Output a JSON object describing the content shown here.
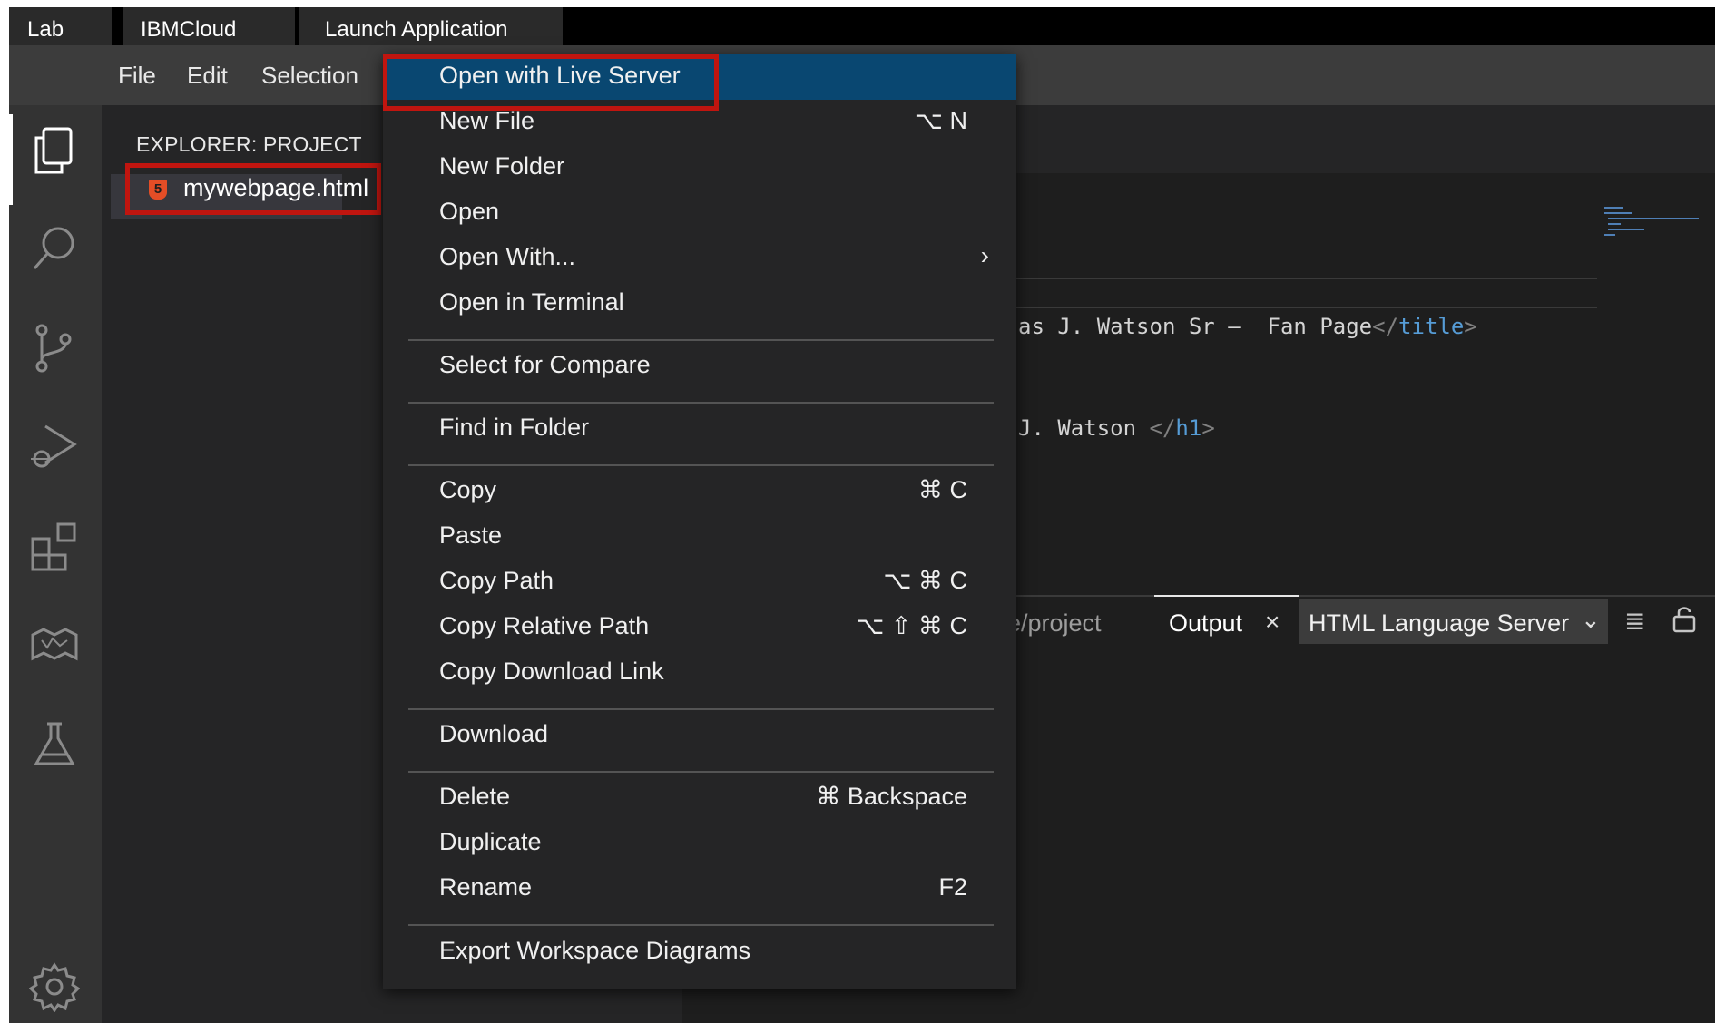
{
  "top_tabs": [
    "Lab",
    "IBMCloud",
    "Launch Application"
  ],
  "menubar": [
    "File",
    "Edit",
    "Selection"
  ],
  "activity_icons": [
    "explorer-icon",
    "search-icon",
    "source-control-icon",
    "run-debug-icon",
    "extensions-icon",
    "map-icon",
    "flask-icon",
    "settings-gear-icon"
  ],
  "explorer": {
    "title": "EXPLORER: PROJECT",
    "file_name": "mywebpage.html",
    "file_icon_glyph": "5"
  },
  "editor": {
    "line1": [
      "as J. Watson Sr –  Fan Page",
      "</",
      "title",
      ">"
    ],
    "line2": [
      "J. Watson ",
      "</",
      "h1",
      ">"
    ]
  },
  "panel": {
    "path_fragment": "e/project",
    "output_tab": "Output",
    "close_glyph": "×",
    "language_select": "HTML Language Server",
    "chevron": "⌄",
    "clear_glyph": "≣",
    "lock_glyph": "🔓"
  },
  "context_menu": {
    "items": [
      {
        "label": "Open with Live Server",
        "key": "",
        "selected": true
      },
      {
        "label": "New File",
        "key": "⌥ N"
      },
      {
        "label": "New Folder",
        "key": ""
      },
      {
        "label": "Open",
        "key": ""
      },
      {
        "label": "Open With...",
        "key": "",
        "submenu": "›"
      },
      {
        "label": "Open in Terminal",
        "key": ""
      },
      {
        "label": "Select for Compare",
        "key": ""
      },
      {
        "label": "Find in Folder",
        "key": ""
      },
      {
        "label": "Copy",
        "key": "⌘ C"
      },
      {
        "label": "Paste",
        "key": ""
      },
      {
        "label": "Copy Path",
        "key": "⌥ ⌘ C"
      },
      {
        "label": "Copy Relative Path",
        "key": "⌥ ⇧ ⌘ C"
      },
      {
        "label": "Copy Download Link",
        "key": ""
      },
      {
        "label": "Download",
        "key": ""
      },
      {
        "label": "Delete",
        "key": "⌘ Backspace"
      },
      {
        "label": "Duplicate",
        "key": ""
      },
      {
        "label": "Rename",
        "key": "F2"
      },
      {
        "label": "Export Workspace Diagrams",
        "key": ""
      }
    ]
  },
  "colors": {
    "highlight_border": "#c0150f",
    "menu_selected": "#094771",
    "html_icon": "#e44d26"
  }
}
